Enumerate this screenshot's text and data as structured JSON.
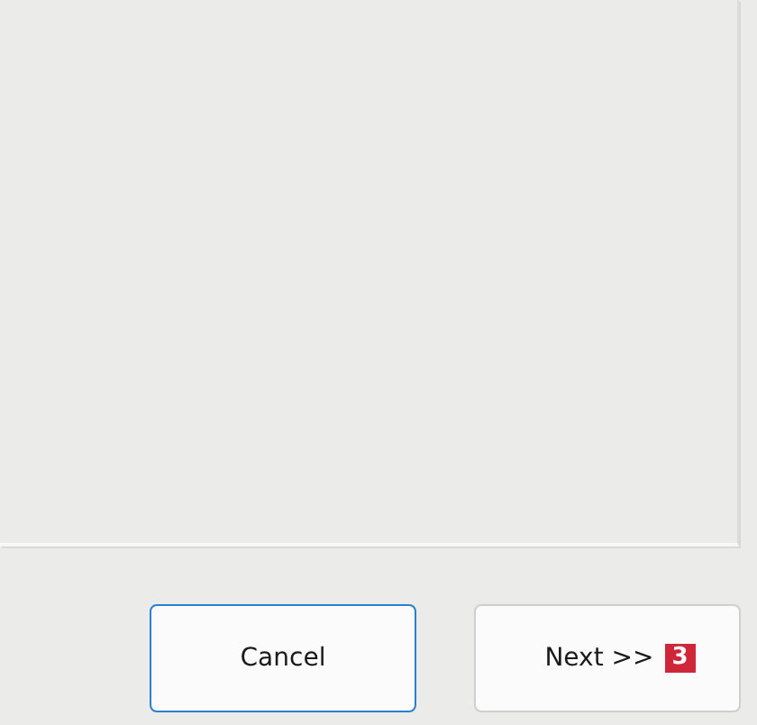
{
  "buttons": [
    {
      "label": "Cancel",
      "focused": true
    },
    {
      "label": "Next >>",
      "focused": false,
      "badge": "3"
    }
  ]
}
